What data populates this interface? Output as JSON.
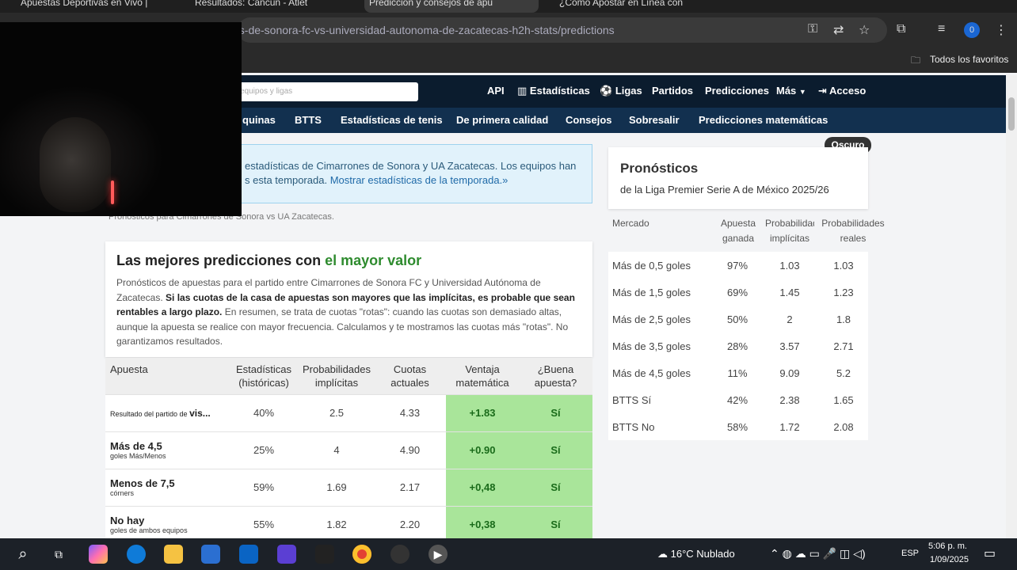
{
  "browser": {
    "tabs": [
      {
        "title": "Apuestas Deportivas en Vivo |",
        "active": false
      },
      {
        "title": "Resultados: Cancún - Atlét",
        "active": false
      },
      {
        "title": "Predicción y consejos de apu",
        "active": true
      },
      {
        "title": "¿Cómo Apostar en Línea con",
        "active": false
      }
    ],
    "url": "es-de-sonora-fc-vs-universidad-autonoma-de-zacatecas-h2h-stats/predictions",
    "bookmarks_label": "Todos los favoritos",
    "profile_initial": "0"
  },
  "site_nav": {
    "search_placeholder": "equipos y ligas",
    "items": [
      "API",
      "Estadísticas",
      "Ligas",
      "Partidos",
      "Predicciones",
      "Más",
      "Acceso"
    ]
  },
  "sub_nav": {
    "items": [
      "quinas",
      "BTTS",
      "Estadísticas de tenis",
      "De primera calidad",
      "Consejos",
      "Sobresalir",
      "Predicciones matemáticas"
    ]
  },
  "info_box": {
    "line1": "estadísticas de Cimarrones de Sonora y UA Zacatecas. Los equipos han",
    "line2_plain": "s esta temporada.",
    "line2_link": "Mostrar estadísticas de la temporada.»"
  },
  "caption": "Pronósticos para Cimarrones de Sonora vs UA Zacatecas.",
  "best_predictions": {
    "title_plain": "Las mejores predicciones con ",
    "title_green": "el mayor valor",
    "para_1": "Pronósticos de apuestas para el partido entre Cimarrones de Sonora FC y Universidad Autónoma de Zacatecas. ",
    "para_bold": "Si las cuotas de la casa de apuestas son mayores que las implícitas, es probable que sean rentables a largo plazo.",
    "para_2": " En resumen, se trata de cuotas \"rotas\": cuando las cuotas son demasiado altas, aunque la apuesta se realice con mayor frecuencia. Calculamos y te mostramos las cuotas más \"rotas\". No garantizamos resultados."
  },
  "pred_table": {
    "headers": [
      "Apuesta",
      "Estadísticas (históricas)",
      "Probabilidades implícitas",
      "Cuotas actuales",
      "Ventaja matemática",
      "¿Buena apuesta?"
    ],
    "rows": [
      {
        "bet_prefix": "Resultado del partido de ",
        "bet_main": "vis...",
        "bet_sub": "",
        "stat": "40%",
        "implied": "2.5",
        "odds": "4.33",
        "edge": "+1.83",
        "good": "Sí"
      },
      {
        "bet_prefix": "",
        "bet_main": "Más de 4,5",
        "bet_sub": "goles Más/Menos",
        "stat": "25%",
        "implied": "4",
        "odds": "4.90",
        "edge": "+0.90",
        "good": "Sí"
      },
      {
        "bet_prefix": "",
        "bet_main": "Menos de 7,5",
        "bet_sub": "córners",
        "stat": "59%",
        "implied": "1.69",
        "odds": "2.17",
        "edge": "+0,48",
        "good": "Sí"
      },
      {
        "bet_prefix": "",
        "bet_main": "No hay",
        "bet_sub": "goles de ambos equipos",
        "stat": "55%",
        "implied": "1.82",
        "odds": "2.20",
        "edge": "+0,38",
        "good": "Sí"
      }
    ]
  },
  "dark_toggle": "Oscuro",
  "pronosticos": {
    "title": "Pronósticos",
    "subtitle": "de la Liga Premier Serie A de México 2025/26"
  },
  "market_table": {
    "headers": [
      "Mercado",
      "Apuesta ganada",
      "Probabilidades implícitas",
      "Probabilidades reales"
    ],
    "rows": [
      {
        "market": "Más de 0,5 goles",
        "won": "97%",
        "implied": "1.03",
        "real": "1.03"
      },
      {
        "market": "Más de 1,5 goles",
        "won": "69%",
        "implied": "1.45",
        "real": "1.23"
      },
      {
        "market": "Más de 2,5 goles",
        "won": "50%",
        "implied": "2",
        "real": "1.8"
      },
      {
        "market": "Más de 3,5 goles",
        "won": "28%",
        "implied": "3.57",
        "real": "2.71"
      },
      {
        "market": "Más de 4,5 goles",
        "won": "11%",
        "implied": "9.09",
        "real": "5.2"
      },
      {
        "market": "BTTS Sí",
        "won": "42%",
        "implied": "2.38",
        "real": "1.65"
      },
      {
        "market": "BTTS No",
        "won": "58%",
        "implied": "1.72",
        "real": "2.08"
      }
    ]
  },
  "taskbar": {
    "weather": "16°C  Nublado",
    "language": "ESP",
    "time": "5:06 p. m.",
    "date": "1/09/2025"
  },
  "colors": {
    "nav_dark": "#0b1c2e",
    "nav_sub": "#12304f",
    "value_green": "#a9e59a",
    "title_green": "#2e8b2e"
  }
}
